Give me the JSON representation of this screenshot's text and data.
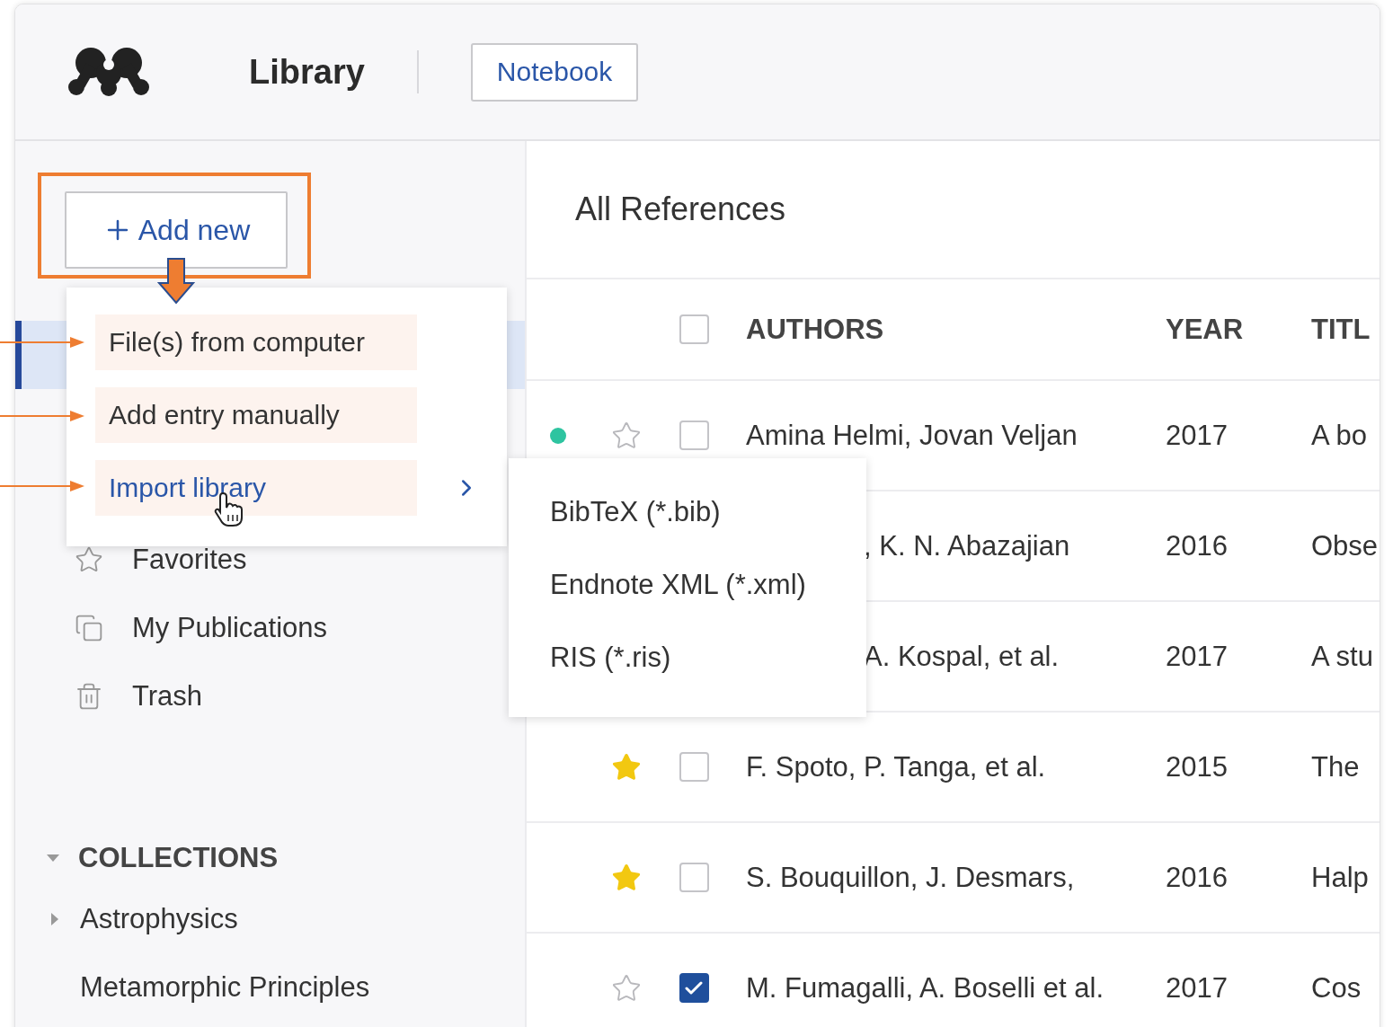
{
  "header": {
    "app": "Library",
    "tab_button": "Notebook"
  },
  "sidebar": {
    "add_button": "Add new",
    "items": [
      {
        "selected": true,
        "kind": "hidden"
      },
      {
        "label": "Favorites",
        "selected": false,
        "kind": "favorites"
      },
      {
        "label": "My Publications",
        "selected": false,
        "kind": "publications"
      },
      {
        "label": "Trash",
        "selected": false,
        "kind": "trash"
      }
    ],
    "collections": {
      "title": "COLLECTIONS",
      "expanded": true,
      "items": [
        {
          "label": "Astrophysics",
          "kind": "group",
          "expanded": false
        },
        {
          "label": "Metamorphic Principles",
          "kind": "leaf"
        }
      ]
    }
  },
  "add_menu": {
    "items": [
      {
        "label": "File(s) from computer",
        "highlighted": false,
        "submenu": false
      },
      {
        "label": "Add entry manually",
        "highlighted": false,
        "submenu": false
      },
      {
        "label": "Import library",
        "highlighted": true,
        "submenu": true
      }
    ]
  },
  "import_submenu": {
    "items": [
      "BibTeX (*.bib)",
      "Endnote XML (*.xml)",
      "RIS (*.ris)"
    ]
  },
  "main": {
    "title": "All References",
    "table": {
      "header_checked": false,
      "columns": [
        "AUTHORS",
        "YEAR",
        "TITL"
      ],
      "rows": [
        {
          "kind": "full",
          "unread": true,
          "starred": false,
          "checked": false,
          "authors": "Amina Helmi, Jovan Veljan",
          "year": "2017",
          "title": "A bo"
        },
        {
          "kind": "covered",
          "authors": ", K. N. Abazajian",
          "year": "2016",
          "title": "Obse"
        },
        {
          "kind": "covered",
          "authors": "A. Kospal, et al.",
          "year": "2017",
          "title": "A stu"
        },
        {
          "kind": "full",
          "unread": false,
          "starred": true,
          "checked": false,
          "authors": "F. Spoto, P. Tanga, et al.",
          "year": "2015",
          "title": "The"
        },
        {
          "kind": "full",
          "unread": false,
          "starred": true,
          "checked": false,
          "authors": "S. Bouquillon, J. Desmars,",
          "year": "2016",
          "title": "Halp"
        },
        {
          "kind": "full",
          "unread": false,
          "starred": false,
          "checked": true,
          "authors": "M. Fumagalli, A. Boselli et al.",
          "year": "2017",
          "title": "Cos"
        }
      ]
    }
  }
}
